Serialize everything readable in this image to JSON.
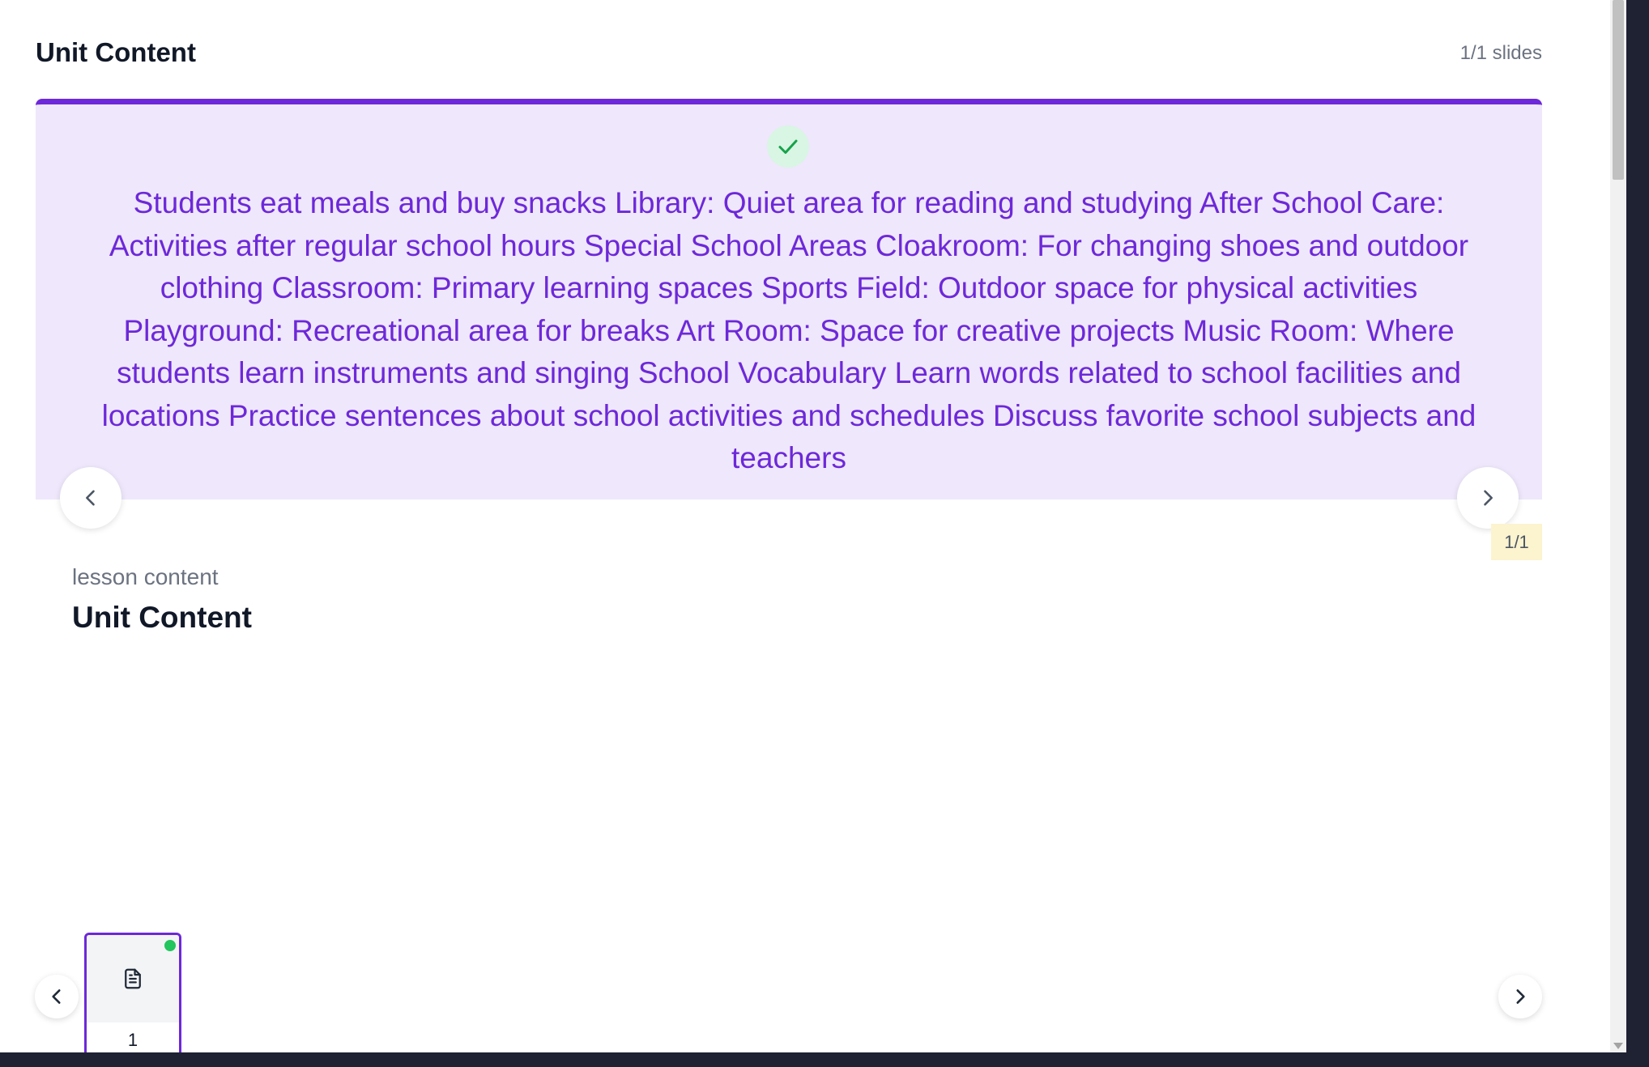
{
  "header": {
    "title": "Unit Content",
    "slide_count": "1/1 slides"
  },
  "slide": {
    "text": "Students eat meals and buy snacks Library: Quiet area for reading and studying After School Care: Activities after regular school hours Special School Areas Cloakroom: For changing shoes and outdoor clothing Classroom: Primary learning spaces Sports Field: Outdoor space for physical activities Playground: Recreational area for breaks Art Room: Space for creative projects Music Room: Where students learn instruments and singing School Vocabulary Learn words related to school facilities and locations Practice sentences about school activities and schedules Discuss favorite school subjects and teachers",
    "page_indicator": "1/1",
    "completed": true
  },
  "lesson": {
    "kind": "lesson content",
    "title": "Unit Content"
  },
  "thumbnails": [
    {
      "number": "1",
      "icon": "document-icon",
      "active": true,
      "status": "completed"
    }
  ],
  "colors": {
    "accent": "#6d28d9",
    "slide_bg": "#efe7fb",
    "success": "#22c55e",
    "indicator_bg": "#fcf3cf"
  }
}
